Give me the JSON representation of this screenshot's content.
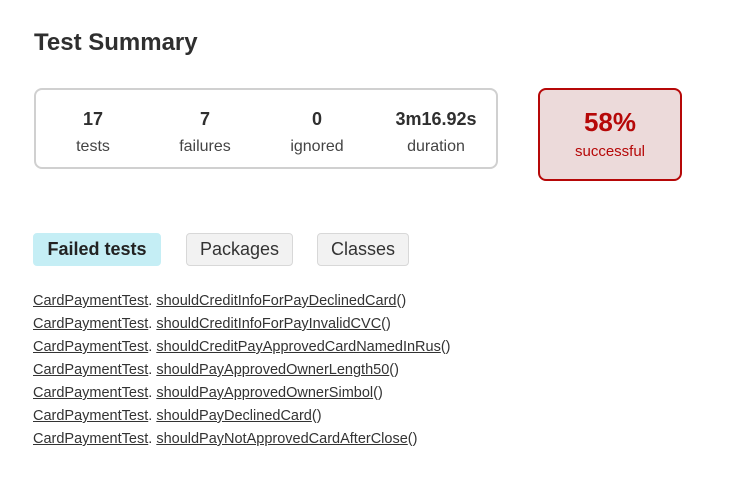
{
  "page": {
    "title": "Test Summary"
  },
  "summary": {
    "tests": {
      "value": "17",
      "label": "tests"
    },
    "failures": {
      "value": "7",
      "label": "failures"
    },
    "ignored": {
      "value": "0",
      "label": "ignored"
    },
    "duration": {
      "value": "3m16.92s",
      "label": "duration"
    }
  },
  "success_rate": {
    "value": "58%",
    "label": "successful",
    "color": "#b60808",
    "background": "#ecdada"
  },
  "tabs": [
    {
      "label": "Failed tests",
      "selected": true
    },
    {
      "label": "Packages",
      "selected": false
    },
    {
      "label": "Classes",
      "selected": false
    }
  ],
  "failed_tests": [
    {
      "class_name": "CardPaymentTest",
      "separator": ".",
      "method": "shouldCreditInfoForPayDeclinedCard",
      "suffix": "()"
    },
    {
      "class_name": "CardPaymentTest",
      "separator": ".",
      "method": "shouldCreditInfoForPayInvalidCVC",
      "suffix": "()"
    },
    {
      "class_name": "CardPaymentTest",
      "separator": ".",
      "method": "shouldCreditPayApprovedCardNamedInRus",
      "suffix": "()"
    },
    {
      "class_name": "CardPaymentTest",
      "separator": ".",
      "method": "shouldPayApprovedOwnerLength50",
      "suffix": "()"
    },
    {
      "class_name": "CardPaymentTest",
      "separator": ".",
      "method": "shouldPayApprovedOwnerSimbol",
      "suffix": "()"
    },
    {
      "class_name": "CardPaymentTest",
      "separator": ".",
      "method": "shouldPayDeclinedCard",
      "suffix": "()"
    },
    {
      "class_name": "CardPaymentTest",
      "separator": ".",
      "method": "shouldPayNotApprovedCardAfterClose",
      "suffix": "()"
    }
  ]
}
